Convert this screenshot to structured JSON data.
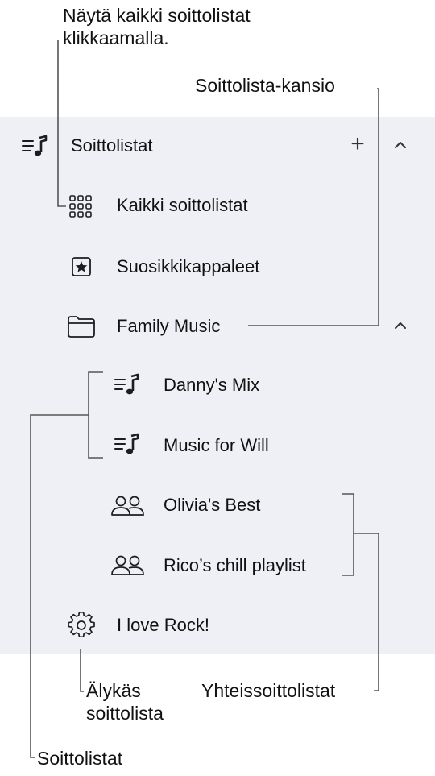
{
  "callouts": {
    "show_all": "Näytä kaikki soittolistat\nklikkaamalla.",
    "folder": "Soittolista-kansio",
    "smart": "Älykäs\nsoittolista",
    "shared": "Yhteissoittolistat",
    "playlists": "Soittolistat"
  },
  "sidebar": {
    "header_label": "Soittolistat",
    "add_symbol": "+",
    "items": [
      {
        "label": "Kaikki soittolistat",
        "icon": "grid-icon"
      },
      {
        "label": "Suosikkikappaleet",
        "icon": "star-box-icon"
      },
      {
        "label": "Family Music",
        "icon": "folder-icon"
      },
      {
        "label": "Danny's Mix",
        "icon": "playlist-icon"
      },
      {
        "label": "Music for Will",
        "icon": "playlist-icon"
      },
      {
        "label": "Olivia's Best",
        "icon": "people-icon"
      },
      {
        "label": "Rico’s chill playlist",
        "icon": "people-icon"
      },
      {
        "label": "I love Rock!",
        "icon": "gear-icon"
      }
    ]
  },
  "colors": {
    "panel_bg": "#eff0f5",
    "line": "#555555",
    "icon": "#1d1d1f"
  }
}
